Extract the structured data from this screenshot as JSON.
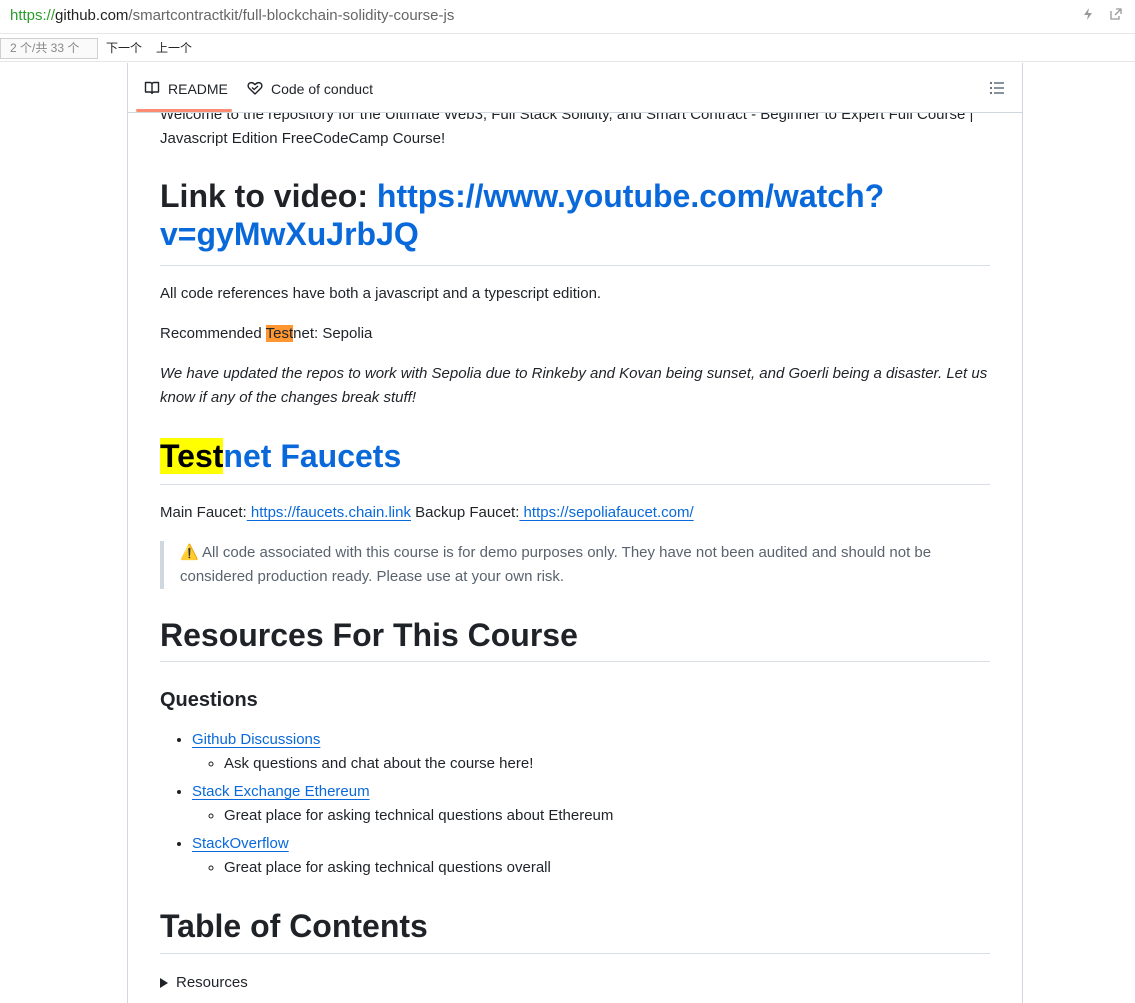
{
  "address_bar": {
    "scheme": "https://",
    "host": "github.com",
    "path": "/smartcontractkit/full-blockchain-solidity-course-js"
  },
  "find_bar": {
    "count": "2 个/共 33 个",
    "next_label": "下一个",
    "prev_label": "上一个"
  },
  "tabs": {
    "readme": "README",
    "code_of_conduct": "Code of conduct"
  },
  "readme": {
    "intro": "Welcome to the repository for the Ultimate Web3, Full Stack Solidity, and Smart Contract - Beginner to Expert Full Course | Javascript Edition FreeCodeCamp Course!",
    "video_heading_prefix": "Link to video: ",
    "video_heading_link": "https://www.youtube.com/watch?v=gyMwXuJrbJQ",
    "code_refs": "All code references have both a javascript and a typescript edition.",
    "recommended_prefix": "Recommended ",
    "recommended_highlight": "Test",
    "recommended_suffix": "net: Sepolia",
    "updated_note": "We have updated the repos to work with Sepolia due to Rinkeby and Kovan being sunset, and Goerli being a disaster. Let us know if any of the changes break stuff!",
    "faucets_heading_highlight": "Test",
    "faucets_heading_rest": "net Faucets",
    "main_faucet_label": "Main Faucet:",
    "main_faucet_link": " https://faucets.chain.link",
    "backup_faucet_label": " Backup Faucet:",
    "backup_faucet_link": " https://sepoliafaucet.com/",
    "warning": "⚠️ All code associated with this course is for demo purposes only. They have not been audited and should not be considered production ready. Please use at your own risk.",
    "resources_heading": "Resources For This Course",
    "questions_heading": "Questions",
    "resources": [
      {
        "label": "Github Discussions",
        "desc": "Ask questions and chat about the course here!"
      },
      {
        "label": "Stack Exchange Ethereum",
        "desc": "Great place for asking technical questions about Ethereum"
      },
      {
        "label": "StackOverflow",
        "desc": "Great place for asking technical questions overall"
      }
    ],
    "toc_heading": "Table of Contents",
    "toc_summary": "Resources"
  },
  "colors": {
    "link": "#0969da",
    "tab_underline": "#fd8c73",
    "find_highlight_current": "#ff9632",
    "find_highlight": "#ffff00"
  }
}
